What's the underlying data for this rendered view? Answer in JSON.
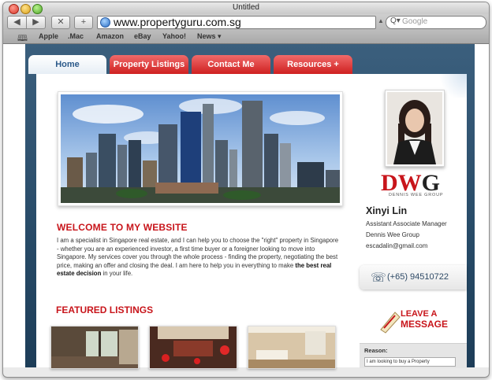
{
  "window": {
    "title": "Untitled"
  },
  "toolbar": {
    "url": "www.propertyguru.com.sg",
    "search_placeholder": "Google",
    "back_icon": "back-arrow-icon",
    "forward_icon": "forward-arrow-icon"
  },
  "bookmarks": [
    "Apple",
    ".Mac",
    "Amazon",
    "eBay",
    "Yahoo!",
    "News ▾"
  ],
  "nav": {
    "tabs": [
      "Home",
      "Property Listings",
      "Contact Me",
      "Resources +"
    ],
    "active": "Home"
  },
  "main": {
    "welcome_title": "WELCOME TO MY WEBSITE",
    "description": "I am a specialist in Singapore real estate, and I can help you to choose the \"right\" property in Singapore - whether you are an experienced investor, a first time buyer or a foreigner looking to move into Singapore. My services cover you through the whole process - finding the property, negotiating the best price, making an offer and closing the deal. I am here to help you in everything to make ",
    "description_bold": "the best real estate decision",
    "description_end": " in your life.",
    "featured_title": "FEATURED LISTINGS"
  },
  "sidebar": {
    "logo_letters": "DWG",
    "logo_subtitle": "DENNIS WEE GROUP",
    "agent_name": "Xinyi Lin",
    "agent_title": "Assistant Associate Manager",
    "agent_company": "Dennis Wee Group",
    "agent_email": "escadalin@gmail.com",
    "phone": "(+65) 94510722",
    "leave_message_line1": "LEAVE A",
    "leave_message_line2": "MESSAGE",
    "reason_label": "Reason:",
    "reason_value": "I am looking to buy a Property"
  },
  "colors": {
    "accent_red": "#c8151b",
    "nav_blue": "#2c5a8a",
    "frame_blue": "#274a67"
  }
}
